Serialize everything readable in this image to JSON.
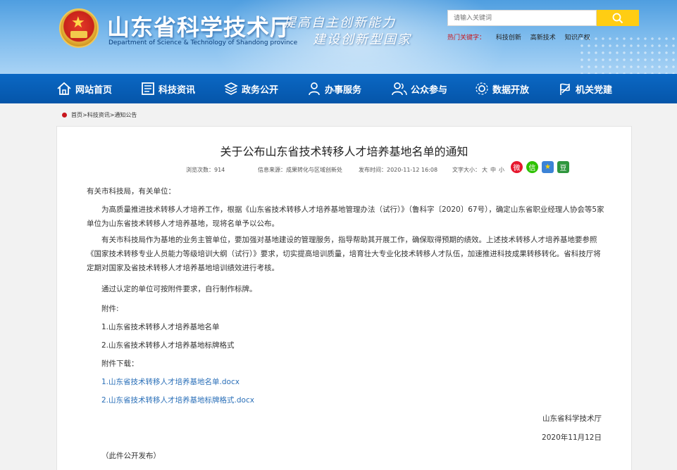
{
  "header": {
    "site_title": "山东省科学技术厅",
    "site_subtitle": "Department of Science & Technology of Shandong province",
    "slogan_line1": "提高自主创新能力",
    "slogan_line2": "建设创新型国家",
    "search": {
      "placeholder": "请输入关键词"
    },
    "hotwords_label": "热门关键字：",
    "hotwords": [
      "科技创新",
      "高新技术",
      "知识产权"
    ]
  },
  "nav": {
    "items": [
      {
        "label": "网站首页",
        "icon": "home-icon"
      },
      {
        "label": "科技资讯",
        "icon": "news-icon"
      },
      {
        "label": "政务公开",
        "icon": "layers-icon"
      },
      {
        "label": "办事服务",
        "icon": "person-service-icon"
      },
      {
        "label": "公众参与",
        "icon": "people-icon"
      },
      {
        "label": "数据开放",
        "icon": "data-icon"
      },
      {
        "label": "机关党建",
        "icon": "party-icon"
      }
    ]
  },
  "breadcrumb": "首页>科技资讯>通知公告",
  "article": {
    "title": "关于公布山东省技术转移人才培养基地名单的通知",
    "views": "浏览次数：914",
    "source": "信息来源：成果转化与区域创新处",
    "publish_time": "发布时间：2020-11-12 16:08",
    "font_size_label": "文字大小：",
    "font_sizes": [
      "大",
      "中",
      "小"
    ],
    "share_icons": [
      {
        "name": "weibo-icon",
        "color": "#e6162d",
        "glyph": "微"
      },
      {
        "name": "wechat-icon",
        "color": "#2dc100",
        "glyph": "信"
      },
      {
        "name": "qzone-icon",
        "color": "#f5b400",
        "glyph": "★"
      },
      {
        "name": "douban-icon",
        "color": "#2e963d",
        "glyph": "豆"
      }
    ],
    "salutation": "有关市科技局，有关单位：",
    "paragraphs": [
      "为高质量推进技术转移人才培养工作，根据《山东省技术转移人才培养基地管理办法（试行）》（鲁科字〔2020〕67号），确定山东省职业经理人协会等5家单位为山东省技术转移人才培养基地，现将名单予以公布。",
      "有关市科技局作为基地的业务主管单位，要加强对基地建设的管理服务，指导帮助其开展工作，确保取得预期的绩效。上述技术转移人才培养基地要参照《国家技术转移专业人员能力等级培训大纲（试行）》要求，切实提高培训质量，培育壮大专业化技术转移人才队伍，加速推进科技成果转移转化。省科技厅将定期对国家及省技术转移人才培养基地培训绩效进行考核。"
    ],
    "notice": "通过认定的单位可按附件要求，自行制作标牌。",
    "attachments_label": "附件:",
    "attachments": [
      "1.山东省技术转移人才培养基地名单",
      "2.山东省技术转移人才培养基地标牌格式"
    ],
    "downloads_label": "附件下载：",
    "downloads": [
      "1.山东省技术转移人才培养基地名单.docx",
      "2.山东省技术转移人才培养基地标牌格式.docx"
    ],
    "signature": "山东省科学技术厅",
    "date": "2020年11月12日",
    "footnote": "（此件公开发布）"
  }
}
